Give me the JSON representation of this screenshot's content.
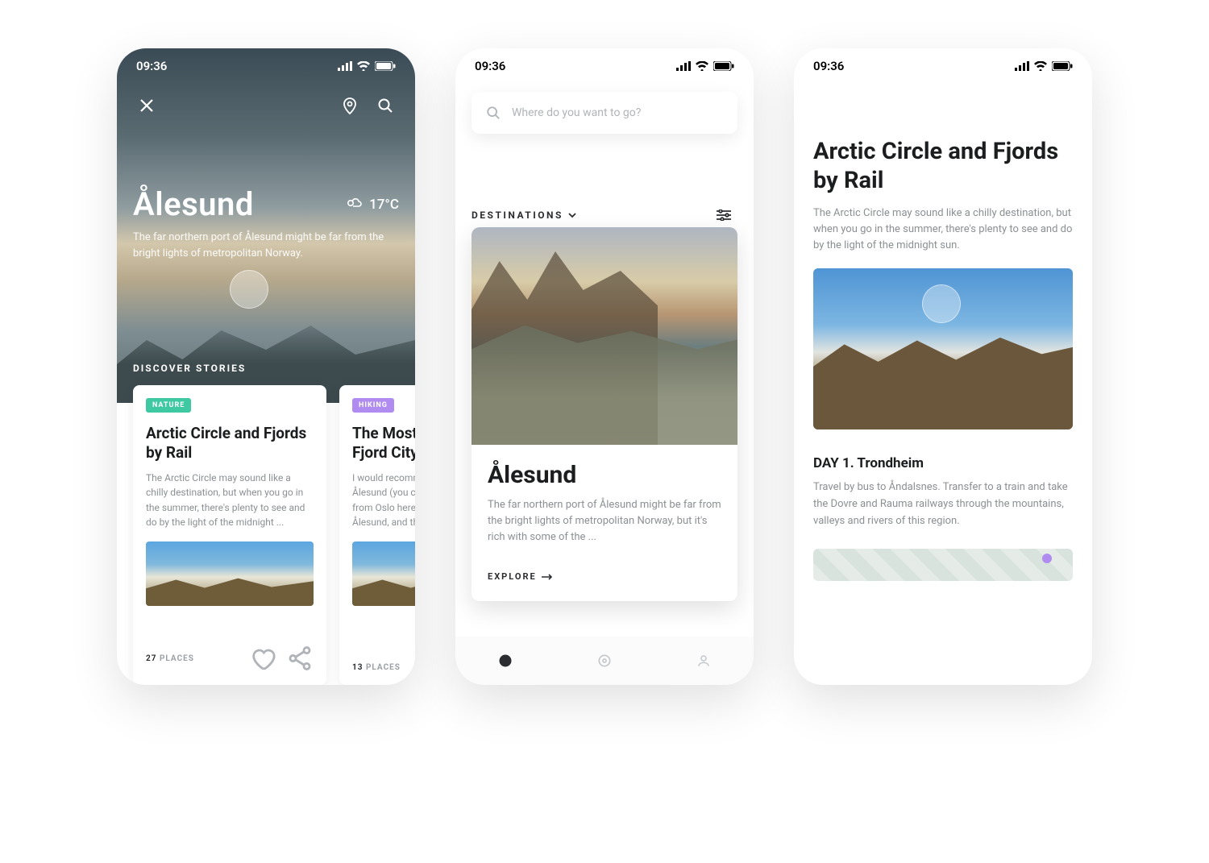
{
  "status": {
    "time": "09:36"
  },
  "phone1": {
    "hero": {
      "title": "Ålesund",
      "temperature": "17°C",
      "description": "The far northern port of Ålesund might be far from the bright lights of metropolitan Norway.",
      "sectionLabel": "DISCOVER STORIES"
    },
    "stories": [
      {
        "badge": "NATURE",
        "badgeClass": "nature",
        "title": "Arctic Circle and Fjords by Rail",
        "excerpt": "The Arctic Circle may sound like a chilly destination, but when you go in the summer, there's plenty to see and do by the light of the midnight ...",
        "placesCount": "27",
        "placesLabel": "PLACES"
      },
      {
        "badge": "HIKING",
        "badgeClass": "hiking",
        "title": "The Most Beautiful Fjord City",
        "excerpt": "I would recommend flying straight into Ålesund (you can find cheap flights from Oslo here), booking a hotel in Ålesund, and then ...",
        "placesCount": "13",
        "placesLabel": "PLACES"
      }
    ]
  },
  "phone2": {
    "search": {
      "placeholder": "Where do you want to go?"
    },
    "sectionLabel": "DESTINATIONS",
    "destination": {
      "title": "Ålesund",
      "description": "The far northern port of Ålesund might be far from the bright lights of metropolitan Norway, but it's rich with some of the ...",
      "cta": "EXPLORE"
    }
  },
  "phone3": {
    "title": "Arctic Circle and Fjords by Rail",
    "lead": "The Arctic Circle may sound like a chilly destination, but when you go in the summer, there's plenty to see and do by the light of the midnight sun.",
    "day": {
      "heading": "DAY 1. Trondheim",
      "body": "Travel by bus to Åndalsnes. Transfer to a train and take the Dovre and Rauma railways through the mountains, valleys and rivers of this region."
    }
  }
}
